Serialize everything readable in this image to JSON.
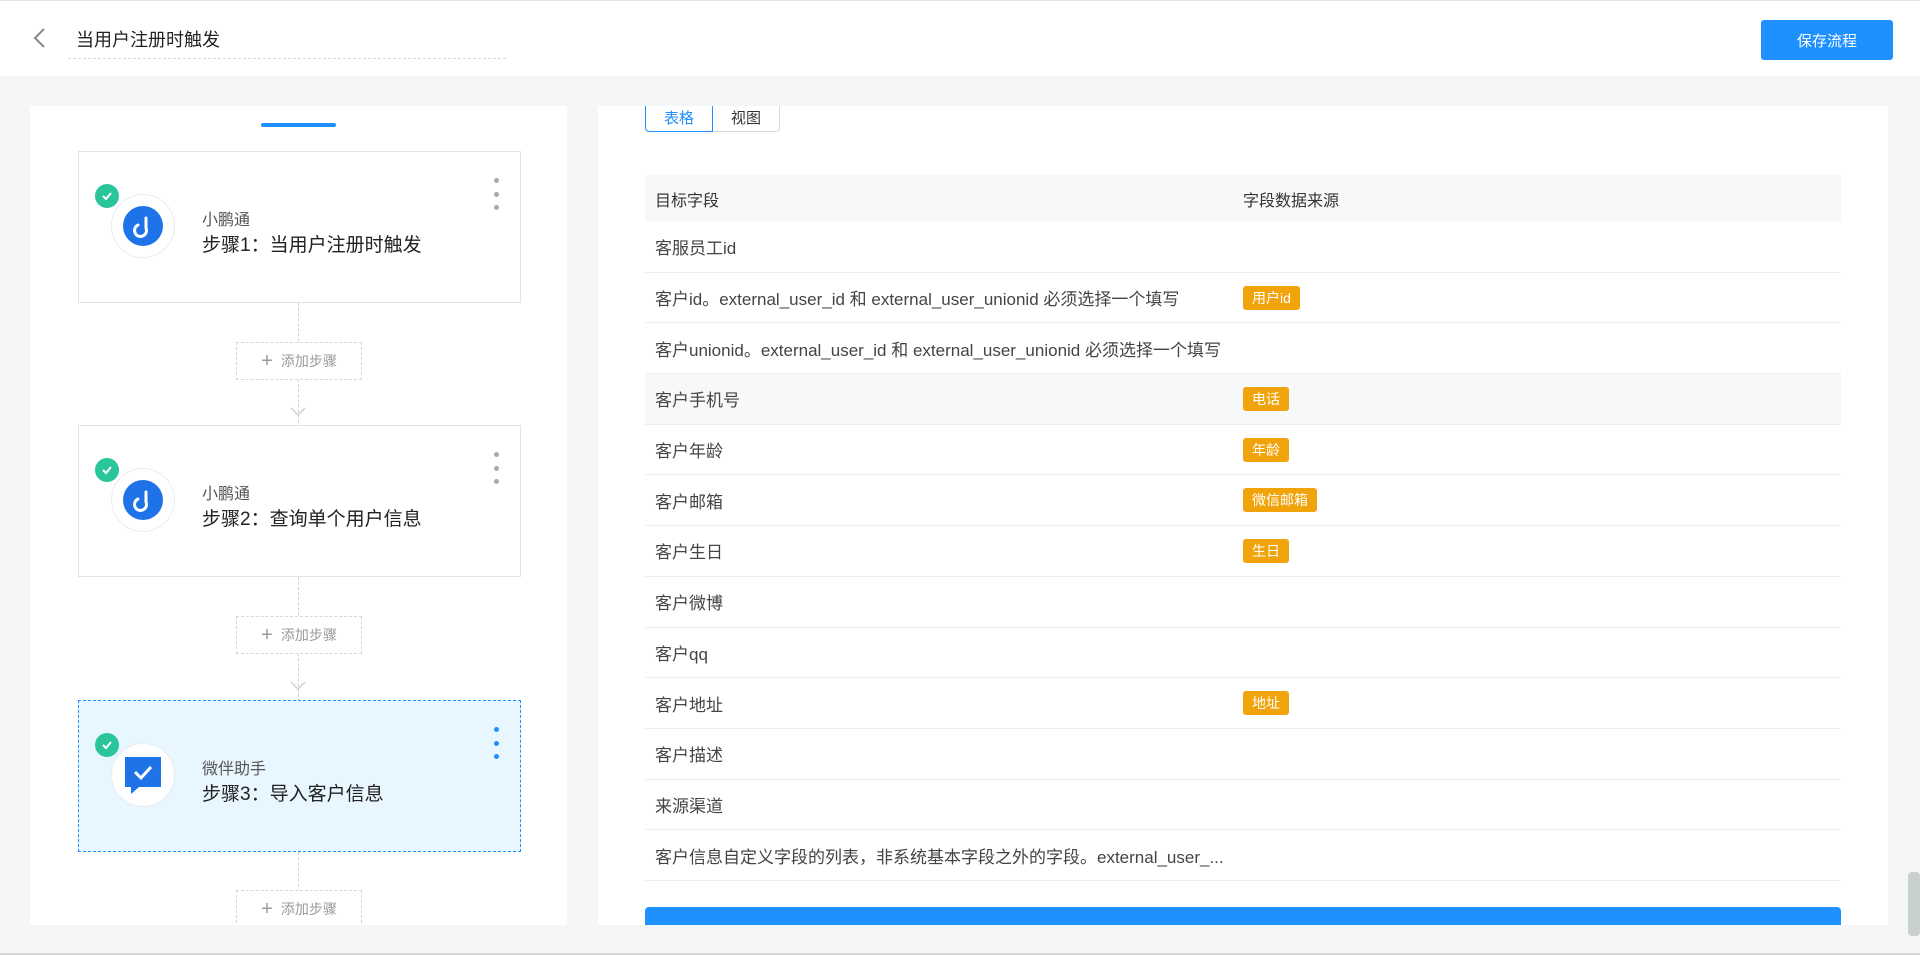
{
  "header": {
    "title": "当用户注册时触发",
    "save_label": "保存流程"
  },
  "steps": [
    {
      "app": "小鹏通",
      "title": "步骤1：当用户注册时触发",
      "icon": "goose-icon",
      "status": "done"
    },
    {
      "app": "小鹏通",
      "title": "步骤2：查询单个用户信息",
      "icon": "goose-icon",
      "status": "done"
    },
    {
      "app": "微伴助手",
      "title": "步骤3：导入客户信息",
      "icon": "chat-check-icon",
      "status": "done",
      "active": true
    }
  ],
  "add_step_label": "添加步骤",
  "tabs": [
    "表格",
    "视图"
  ],
  "table": {
    "headers": [
      "目标字段",
      "字段数据来源"
    ],
    "rows": [
      {
        "field": "客服员工id",
        "source": ""
      },
      {
        "field": "客户id。external_user_id 和 external_user_unionid 必须选择一个填写",
        "source": "用户id"
      },
      {
        "field": "客户unionid。external_user_id 和 external_user_unionid 必须选择一个填写",
        "source": ""
      },
      {
        "field": "客户手机号",
        "source": "电话"
      },
      {
        "field": "客户年龄",
        "source": "年龄"
      },
      {
        "field": "客户邮箱",
        "source": "微信邮箱"
      },
      {
        "field": "客户生日",
        "source": "生日"
      },
      {
        "field": "客户微博",
        "source": ""
      },
      {
        "field": "客户qq",
        "source": ""
      },
      {
        "field": "客户地址",
        "source": "地址"
      },
      {
        "field": "客户描述",
        "source": ""
      },
      {
        "field": "来源渠道",
        "source": ""
      },
      {
        "field": "客户信息自定义字段的列表，非系统基本字段之外的字段。external_user_...",
        "source": ""
      }
    ]
  },
  "colors": {
    "primary": "#1e90ff",
    "tag": "#f0a30a",
    "success": "#2bc59c"
  }
}
